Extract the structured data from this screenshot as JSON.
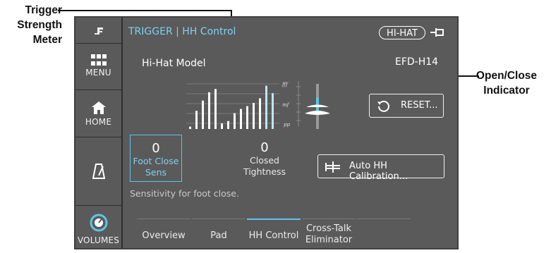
{
  "callouts": {
    "left": {
      "line1": "Trigger",
      "line2": "Strength",
      "line3": "Meter"
    },
    "right": {
      "line1": "Open/Close",
      "line2": "Indicator"
    }
  },
  "sidebar": {
    "top_icon": "f-logo-icon",
    "items": [
      {
        "label": "MENU",
        "icon": "grid-icon"
      },
      {
        "label": "HOME",
        "icon": "home-icon"
      },
      {
        "label": "",
        "icon": "metronome-icon"
      },
      {
        "label": "VOLUMES",
        "icon": "volume-knob-icon"
      }
    ]
  },
  "header": {
    "title": "TRIGGER | HH Control",
    "pill": "HI-HAT",
    "pin_icon": "pin-icon"
  },
  "model": {
    "label": "Hi-Hat Model",
    "value": "EFD-H14"
  },
  "meter": {
    "scale_labels": [
      "fff",
      "mf",
      "pp"
    ],
    "levels": [
      0.05,
      0.39,
      0.61,
      0.79,
      0.86,
      0.12,
      0.17,
      0.34,
      0.43,
      0.49,
      0.56,
      0.66,
      0.93,
      0.77
    ]
  },
  "open_close": {
    "position": 0.35
  },
  "buttons": {
    "reset": "RESET...",
    "auto_hh": "Auto HH Calibration..."
  },
  "params": {
    "foot_close": {
      "value": "0",
      "line1": "Foot Close",
      "line2": "Sens"
    },
    "closed_tightness": {
      "value": "0",
      "line1": "Closed",
      "line2": "Tightness"
    }
  },
  "hint": "Sensitivity for foot close.",
  "tabs": [
    {
      "line1": "Overview",
      "line2": ""
    },
    {
      "line1": "Pad",
      "line2": ""
    },
    {
      "line1": "HH Control",
      "line2": ""
    },
    {
      "line1": "Cross-Talk",
      "line2": "Eliminator"
    }
  ],
  "colors": {
    "accent": "#5bc5ea",
    "panel": "#5a5a5a",
    "callout_dot": "#1b6aa8"
  }
}
